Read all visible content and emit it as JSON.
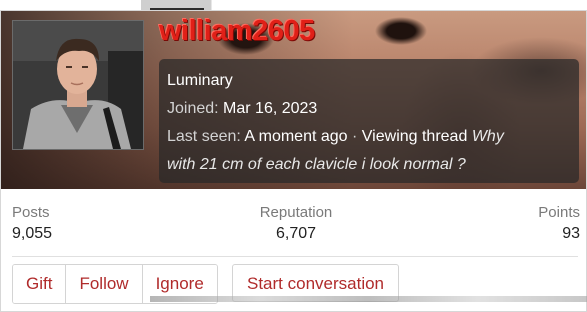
{
  "profile": {
    "username": "william2605",
    "title": "Luminary",
    "joined_label": "Joined:",
    "joined_value": "Mar 16, 2023",
    "last_seen_label": "Last seen:",
    "last_seen_value": "A moment ago",
    "separator": "·",
    "activity": "Viewing thread",
    "thread_title_line1": "Why",
    "thread_title_line2": "with 21 cm of each clavicle i look normal ?"
  },
  "stats": {
    "posts": {
      "label": "Posts",
      "value": "9,055"
    },
    "reputation": {
      "label": "Reputation",
      "value": "6,707"
    },
    "points": {
      "label": "Points",
      "value": "93"
    }
  },
  "actions": {
    "gift": "Gift",
    "follow": "Follow",
    "ignore": "Ignore",
    "start_conversation": "Start conversation"
  },
  "colors": {
    "username": "#e02018",
    "button_text": "#b02b2b",
    "stat_label": "#7a7a7a"
  }
}
